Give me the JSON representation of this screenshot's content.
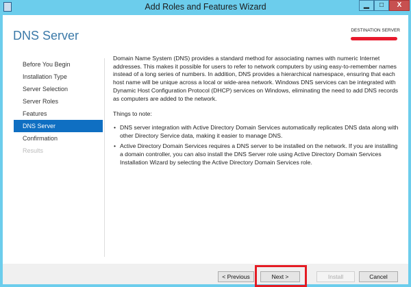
{
  "window": {
    "title": "Add Roles and Features Wizard",
    "minimize": "▁",
    "maximize": "□",
    "close": "X"
  },
  "page": {
    "heading": "DNS Server",
    "destination_label": "DESTINATION SERVER"
  },
  "nav": {
    "items": [
      {
        "label": "Before You Begin",
        "state": "normal"
      },
      {
        "label": "Installation Type",
        "state": "normal"
      },
      {
        "label": "Server Selection",
        "state": "normal"
      },
      {
        "label": "Server Roles",
        "state": "normal"
      },
      {
        "label": "Features",
        "state": "normal"
      },
      {
        "label": "DNS Server",
        "state": "selected"
      },
      {
        "label": "Confirmation",
        "state": "normal"
      },
      {
        "label": "Results",
        "state": "disabled"
      }
    ]
  },
  "content": {
    "intro": "Domain Name System (DNS) provides a standard method for associating names with numeric Internet addresses. This makes it possible for users to refer to network computers by using easy-to-remember names instead of a long series of numbers. In addition, DNS provides a hierarchical namespace, ensuring that each host name will be unique across a local or wide-area network. Windows DNS services can be integrated with Dynamic Host Configuration Protocol (DHCP) services on Windows, eliminating the need to add DNS records as computers are added to the network.",
    "notes_heading": "Things to note:",
    "notes": [
      "DNS server integration with Active Directory Domain Services automatically replicates DNS data along with other Directory Service data, making it easier to manage DNS.",
      "Active Directory Domain Services requires a DNS server to be installed on the network. If you are installing a domain controller, you can also install the DNS Server role using Active Directory Domain Services Installation Wizard by selecting the Active Directory Domain Services role."
    ]
  },
  "buttons": {
    "previous": "< Previous",
    "next": "Next >",
    "install": "Install",
    "cancel": "Cancel"
  },
  "colors": {
    "accent": "#0f6fc2",
    "frame": "#6ccdec",
    "highlight": "#e41b23"
  }
}
